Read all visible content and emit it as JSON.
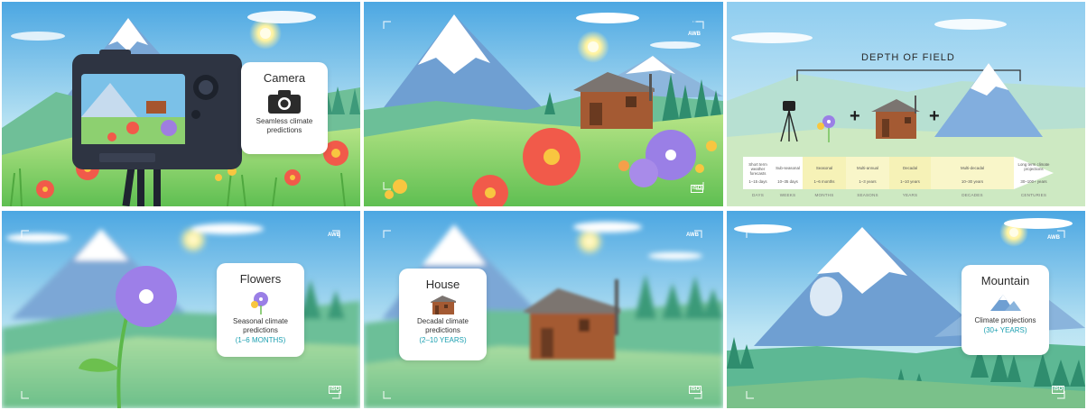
{
  "panels": {
    "camera": {
      "title": "Camera",
      "description_line1": "Seamless climate",
      "description_line2": "predictions",
      "icon": "camera-icon"
    },
    "viewfinder": {
      "badge_top": "AWB",
      "badge_bottom": "ISO"
    },
    "depth_of_field": {
      "title": "DEPTH OF FIELD",
      "timeline": [
        {
          "top": "Short term weather forecasts",
          "range": "1–15 days",
          "label": "DAYS"
        },
        {
          "top": "Sub-seasonal",
          "range": "10–35 days",
          "label": "WEEKS"
        },
        {
          "top": "Seasonal",
          "range": "1–6 months",
          "label": "MONTHS"
        },
        {
          "top": "Multi-annual",
          "range": "1–3 years",
          "label": "SEASONS"
        },
        {
          "top": "Decadal",
          "range": "1–10 years",
          "label": "YEARS"
        },
        {
          "top": "Multi-decadal",
          "range": "10–30 years",
          "label": "DECADES"
        },
        {
          "top": "Long term climate projections",
          "range": "30–100+ years",
          "label": "CENTURIES"
        }
      ]
    },
    "flowers": {
      "title": "Flowers",
      "description_line1": "Seasonal climate",
      "description_line2": "predictions",
      "accent": "(1–6 MONTHS)",
      "badge_top": "AWB",
      "badge_bottom": "ISO"
    },
    "house": {
      "title": "House",
      "description_line1": "Decadal climate",
      "description_line2": "predictions",
      "accent": "(2–10 YEARS)",
      "badge_top": "AWB",
      "badge_bottom": "ISO"
    },
    "mountain": {
      "title": "Mountain",
      "description_line1": "Climate projections",
      "accent": "(30+ YEARS)",
      "badge_top": "AWB",
      "badge_bottom": "ISO"
    }
  },
  "colors": {
    "sky_top": "#5fb3e6",
    "sky_bottom": "#c9ecf5",
    "grass": "#8fd06a",
    "accent_teal": "#1a9fb0",
    "camera_body": "#2e3442",
    "timeline_yellow": "#f6f2b7"
  }
}
